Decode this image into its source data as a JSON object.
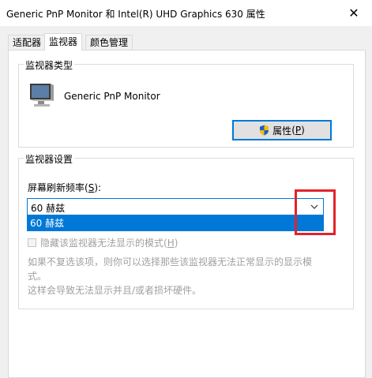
{
  "window": {
    "title": "Generic PnP Monitor 和 Intel(R) UHD Graphics 630 属性",
    "close_glyph": "✕"
  },
  "tabs": [
    {
      "label": "适配器",
      "active": false
    },
    {
      "label": "监视器",
      "active": true
    },
    {
      "label": "颜色管理",
      "active": false
    }
  ],
  "monitor_type": {
    "group_title": "监视器类型",
    "monitor_name": "Generic PnP Monitor",
    "properties_button": {
      "label": "属性",
      "mnemonic": "P",
      "icon": "uac-shield-icon"
    }
  },
  "monitor_settings": {
    "group_title": "监视器设置",
    "refresh_label": "屏幕刷新频率",
    "refresh_mnemonic": "S",
    "selected_value": "60 赫兹",
    "options": [
      "60 赫兹"
    ],
    "hide_modes_checkbox": {
      "label": "隐藏该监视器无法显示的模式",
      "mnemonic": "H",
      "checked": false,
      "enabled": false
    },
    "description_line1": "如果不复选该项，则你可以选择那些该监视器无法正常显示的显示模式。",
    "description_line2": "这样会导致无法显示并且/或者损坏硬件。"
  },
  "colors": {
    "accent": "#0078d7",
    "highlight": "#e3222a",
    "disabled_text": "#a0a0a0"
  }
}
